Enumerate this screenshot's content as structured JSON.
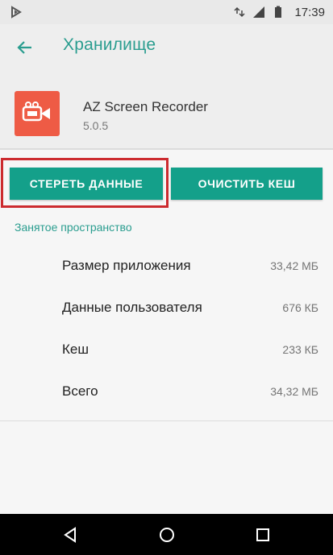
{
  "status_bar": {
    "time": "17:39",
    "icons": [
      "play-store-notification-icon",
      "data-arrows-icon",
      "signal-icon",
      "battery-icon"
    ]
  },
  "app_bar": {
    "back_icon": "arrow-back-icon",
    "title": "Хранилище"
  },
  "app": {
    "name": "AZ Screen Recorder",
    "version": "5.0.5",
    "icon_color": "#ee5b45"
  },
  "actions": {
    "clear_data_label": "СТЕРЕТЬ ДАННЫЕ",
    "clear_cache_label": "ОЧИСТИТЬ КЕШ",
    "button_color": "#14a08a",
    "highlight_color": "#cc2b2f"
  },
  "storage": {
    "section_title": "Занятое пространство",
    "rows": [
      {
        "label": "Размер приложения",
        "value": "33,42 МБ"
      },
      {
        "label": "Данные пользователя",
        "value": "676 КБ"
      },
      {
        "label": "Кеш",
        "value": "233 КБ"
      },
      {
        "label": "Всего",
        "value": "34,32 МБ"
      }
    ]
  },
  "nav_bar": {
    "icons": [
      "back-triangle-icon",
      "home-circle-icon",
      "recents-square-icon"
    ]
  },
  "colors": {
    "accent": "#2a9d8f"
  }
}
